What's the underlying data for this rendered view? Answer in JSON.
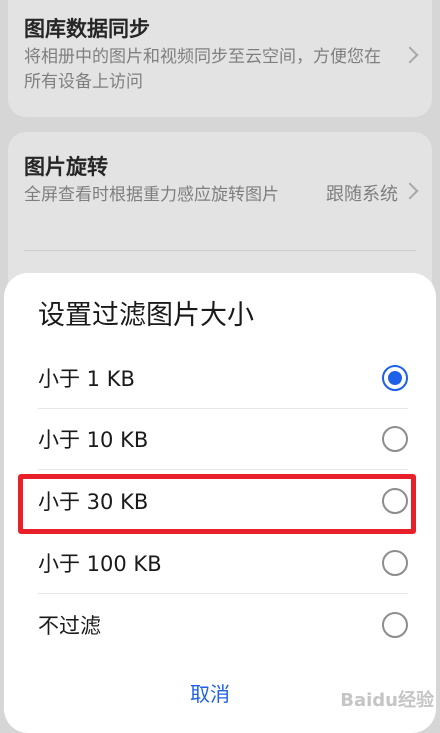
{
  "background": {
    "gallery_sync": {
      "title": "图库数据同步",
      "description": "将相册中的图片和视频同步至云空间，方便您在所有设备上访问"
    },
    "image_rotation": {
      "title": "图片旋转",
      "description": "全屏查看时根据重力感应旋转图片",
      "value": "跟随系统"
    }
  },
  "dialog": {
    "title": "设置过滤图片大小",
    "options": [
      {
        "label": "小于 1 KB",
        "selected": true
      },
      {
        "label": "小于 10 KB",
        "selected": false
      },
      {
        "label": "小于 30 KB",
        "selected": false
      },
      {
        "label": "小于 100 KB",
        "selected": false
      },
      {
        "label": "不过滤",
        "selected": false
      }
    ],
    "cancel_label": "取消"
  },
  "annotation": {
    "highlight_color": "#e8202a",
    "highlighted_option": "小于 30 KB"
  },
  "watermark": {
    "text": "Baidu经验"
  },
  "colors": {
    "accent": "#1f60e8"
  }
}
